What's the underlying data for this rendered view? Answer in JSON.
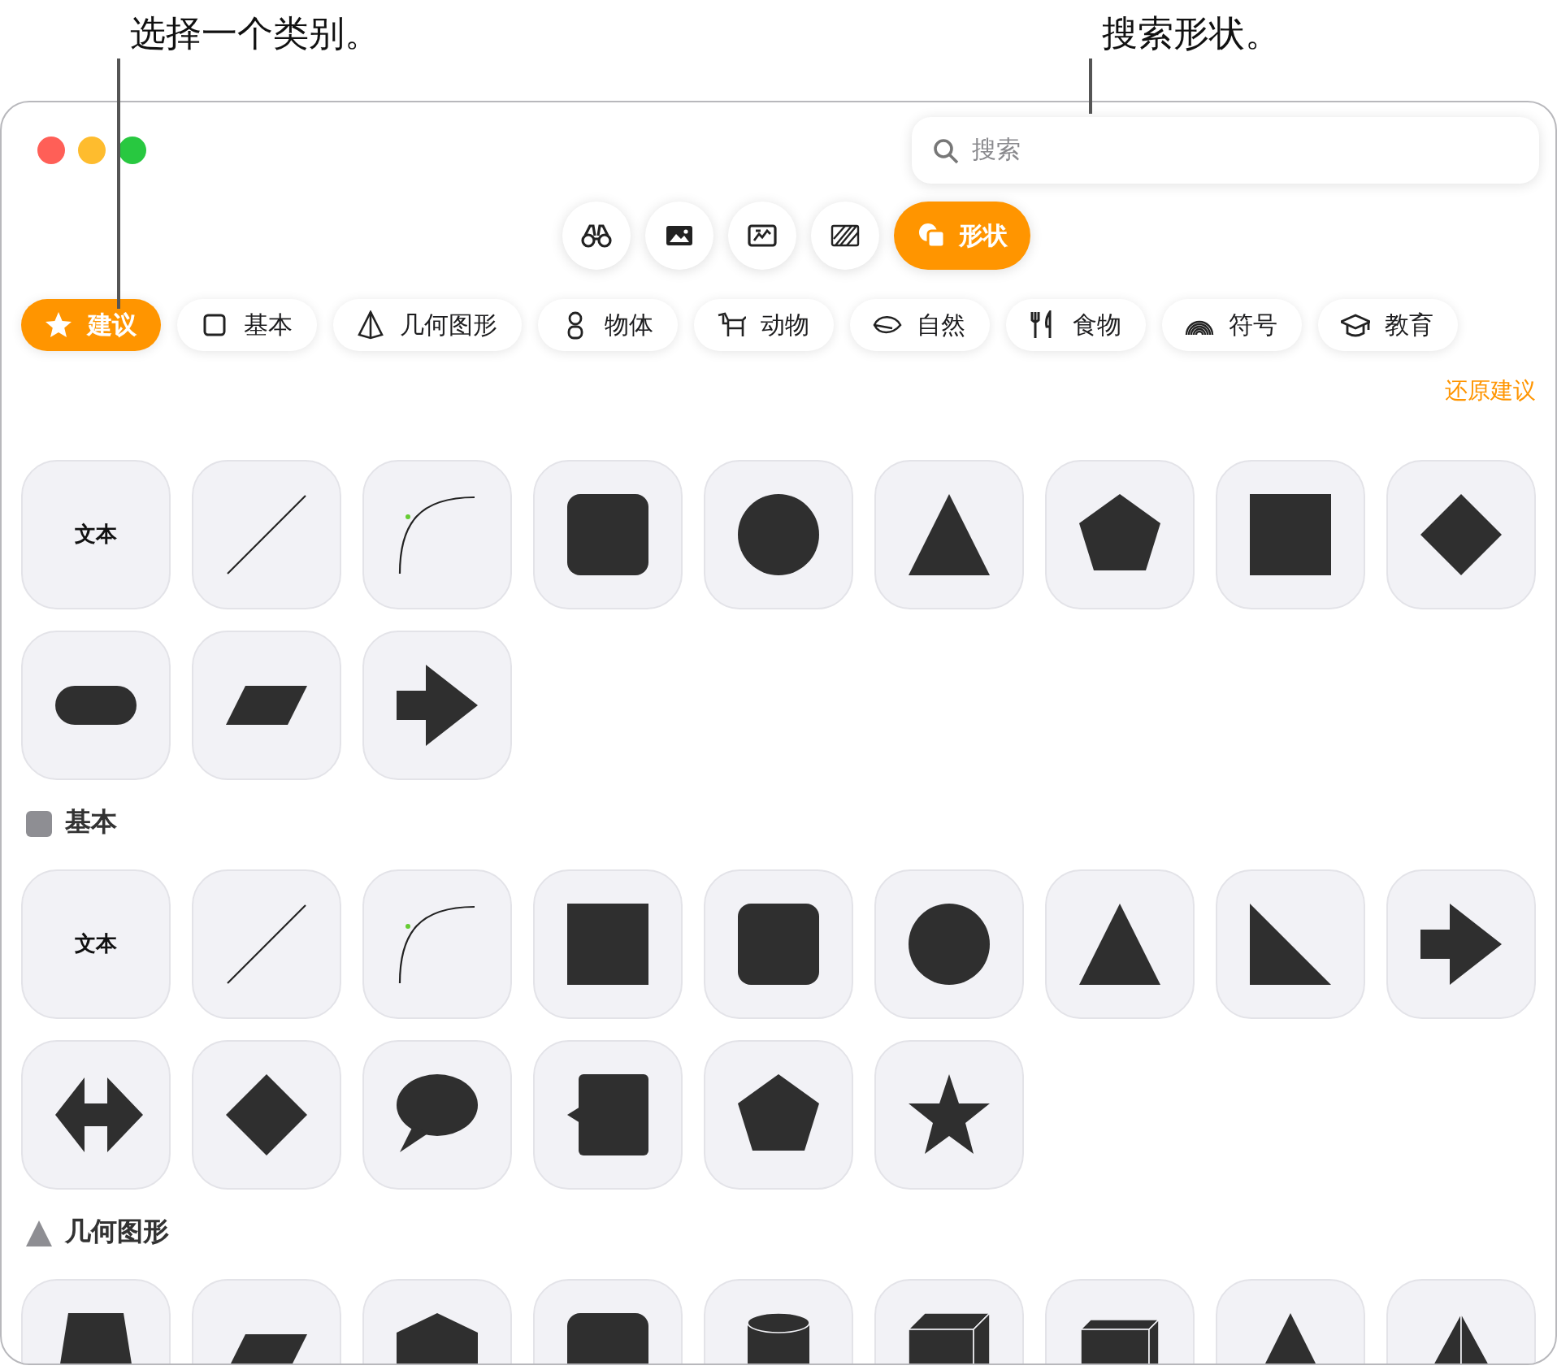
{
  "callouts": [
    {
      "text": "选择一个类别。"
    },
    {
      "text": "搜索形状。"
    }
  ],
  "search": {
    "placeholder": "搜索"
  },
  "toolbar": [
    {
      "kind": "binoculars",
      "selected": false
    },
    {
      "kind": "photo",
      "selected": false
    },
    {
      "kind": "sticker",
      "selected": false
    },
    {
      "kind": "pattern",
      "selected": false
    },
    {
      "kind": "shapes",
      "label": "形状",
      "selected": true
    }
  ],
  "categories": [
    {
      "kind": "star",
      "label": "建议",
      "selected": true
    },
    {
      "kind": "square",
      "label": "基本",
      "selected": false
    },
    {
      "kind": "pyramid",
      "label": "几何图形",
      "selected": false
    },
    {
      "kind": "bulb",
      "label": "物体",
      "selected": false
    },
    {
      "kind": "dog",
      "label": "动物",
      "selected": false
    },
    {
      "kind": "leaf",
      "label": "自然",
      "selected": false
    },
    {
      "kind": "fork",
      "label": "食物",
      "selected": false
    },
    {
      "kind": "rainbow",
      "label": "符号",
      "selected": false
    },
    {
      "kind": "cap",
      "label": "教育",
      "selected": false
    }
  ],
  "restore_link": "还原建议",
  "sections": [
    {
      "shapes": [
        {
          "kind": "text",
          "label": "文本"
        },
        {
          "kind": "line"
        },
        {
          "kind": "curve"
        },
        {
          "kind": "rounded-square"
        },
        {
          "kind": "circle"
        },
        {
          "kind": "triangle"
        },
        {
          "kind": "pentagon"
        },
        {
          "kind": "square"
        },
        {
          "kind": "diamond"
        },
        {
          "kind": "pill"
        },
        {
          "kind": "parallelogram"
        },
        {
          "kind": "arrow"
        }
      ]
    },
    {
      "title": "基本",
      "kind": "square",
      "shapes": [
        {
          "kind": "text",
          "label": "文本"
        },
        {
          "kind": "line"
        },
        {
          "kind": "curve"
        },
        {
          "kind": "square"
        },
        {
          "kind": "rounded-square"
        },
        {
          "kind": "circle"
        },
        {
          "kind": "triangle"
        },
        {
          "kind": "right-triangle"
        },
        {
          "kind": "arrow"
        },
        {
          "kind": "double-arrow"
        },
        {
          "kind": "diamond"
        },
        {
          "kind": "speech-bubble"
        },
        {
          "kind": "callout-square"
        },
        {
          "kind": "pentagon"
        },
        {
          "kind": "star"
        }
      ]
    },
    {
      "title": "几何图形",
      "kind": "pyramid",
      "shapes": [
        {
          "kind": "trapezoid"
        },
        {
          "kind": "parallelogram"
        },
        {
          "kind": "house"
        },
        {
          "kind": "rounded-square"
        },
        {
          "kind": "cylinder"
        },
        {
          "kind": "cube"
        },
        {
          "kind": "cuboid"
        },
        {
          "kind": "triangle"
        },
        {
          "kind": "pyramid"
        }
      ]
    }
  ]
}
